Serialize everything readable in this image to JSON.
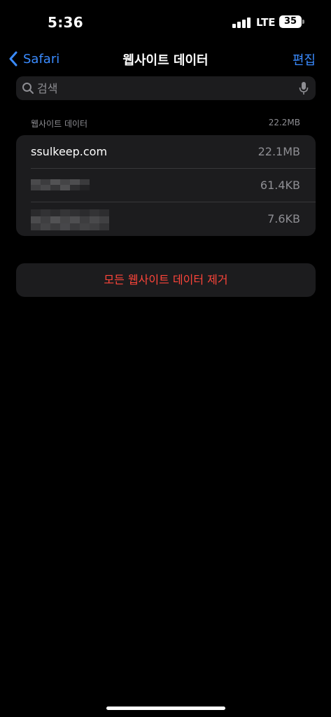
{
  "status_bar": {
    "time": "5:36",
    "network": "LTE",
    "battery": "35"
  },
  "nav": {
    "back_label": "Safari",
    "title": "웹사이트 데이터",
    "edit_label": "편집"
  },
  "search": {
    "placeholder": "검색",
    "value": ""
  },
  "section": {
    "header": "웹사이트 데이터",
    "total_size": "22.2MB"
  },
  "websites": [
    {
      "name": "ssulkeep.com",
      "size": "22.1MB",
      "redacted": false
    },
    {
      "name": "",
      "size": "61.4KB",
      "redacted": true
    },
    {
      "name": "",
      "size": "7.6KB",
      "redacted": true
    }
  ],
  "actions": {
    "remove_all_label": "모든 웹사이트 데이터 제거"
  },
  "colors": {
    "accent": "#3a8bff",
    "destructive": "#ff453a",
    "background": "#000000",
    "cell": "#1c1c1e",
    "secondary_text": "#8e8e93"
  }
}
